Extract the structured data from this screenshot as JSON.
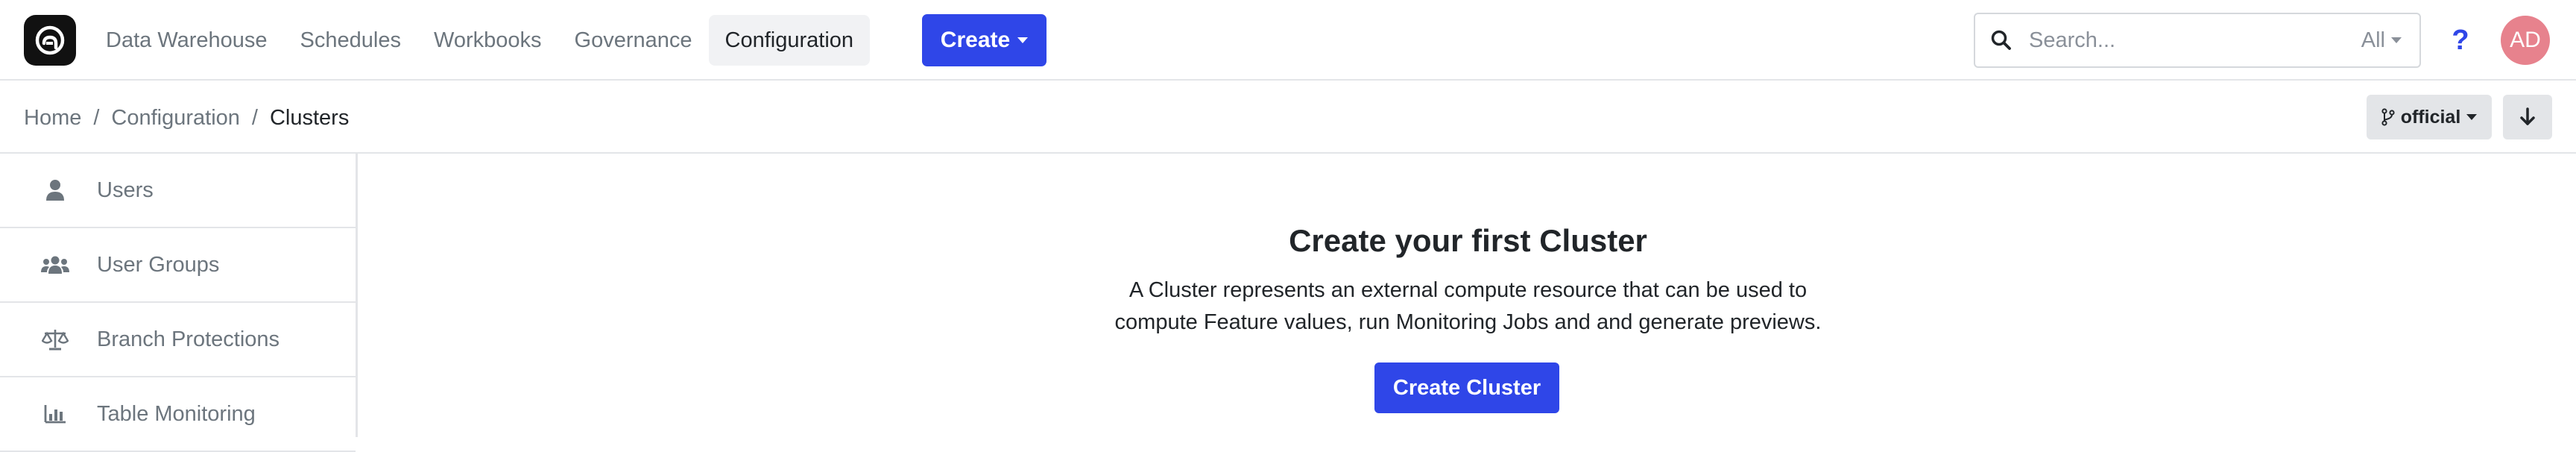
{
  "nav": {
    "links": [
      "Data Warehouse",
      "Schedules",
      "Workbooks",
      "Governance",
      "Configuration"
    ],
    "active": "Configuration",
    "create_label": "Create"
  },
  "search": {
    "placeholder": "Search...",
    "scope": "All"
  },
  "help": {
    "label": "?"
  },
  "user": {
    "initials": "AD"
  },
  "breadcrumb": {
    "home": "Home",
    "section": "Configuration",
    "current": "Clusters",
    "separator": "/"
  },
  "branch": {
    "label": "official"
  },
  "sidebar": {
    "items": [
      {
        "label": "Users",
        "icon": "user-icon"
      },
      {
        "label": "User Groups",
        "icon": "users-icon"
      },
      {
        "label": "Branch Protections",
        "icon": "scale-icon"
      },
      {
        "label": "Table Monitoring",
        "icon": "bar-chart-icon"
      }
    ]
  },
  "empty_state": {
    "title": "Create your first Cluster",
    "description_line1": "A Cluster represents an external compute resource that can be used to",
    "description_line2": "compute Feature values, run Monitoring Jobs and and generate previews.",
    "button_label": "Create Cluster"
  },
  "colors": {
    "primary": "#2f46e8",
    "avatar": "#e7828d",
    "border": "#e3e5e8",
    "muted_text": "#6c757d"
  }
}
